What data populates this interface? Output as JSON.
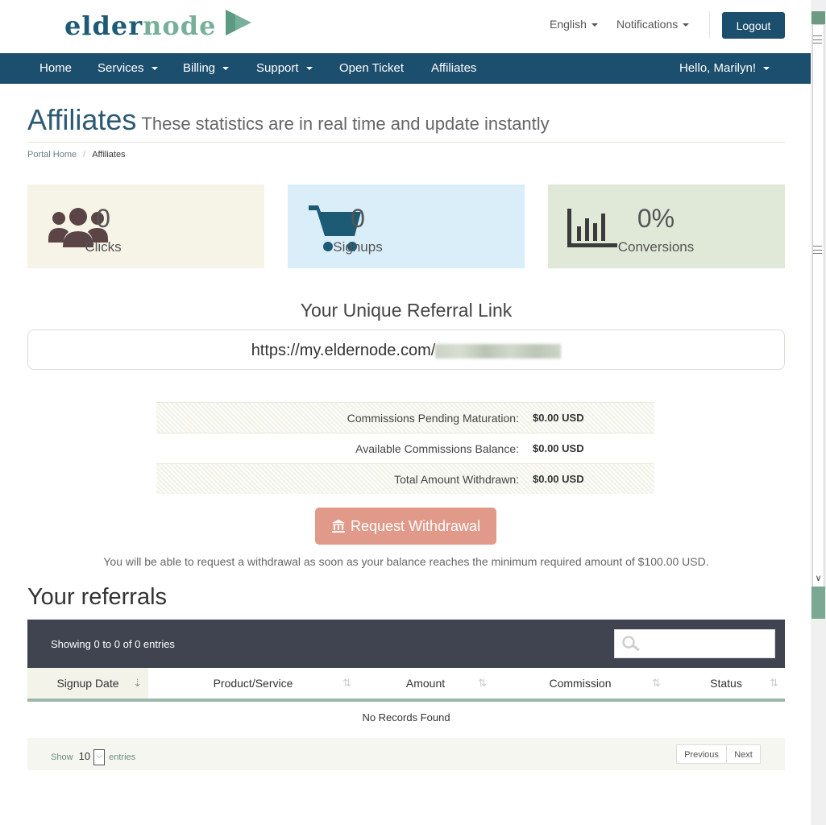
{
  "header": {
    "logo": {
      "part1": "elder",
      "part2": "node"
    },
    "language": "English",
    "notifications": "Notifications",
    "logout": "Logout"
  },
  "nav": {
    "home": "Home",
    "services": "Services",
    "billing": "Billing",
    "support": "Support",
    "open_ticket": "Open Ticket",
    "affiliates": "Affiliates",
    "user_greeting": "Hello, Marilyn!"
  },
  "page": {
    "title": "Affiliates",
    "subtitle": "These statistics are in real time and update instantly",
    "breadcrumb": {
      "home": "Portal Home",
      "current": "Affiliates"
    }
  },
  "stats": {
    "clicks": {
      "value": "0",
      "label": "Clicks",
      "icon": "users-icon",
      "bg": "#f6f3e7"
    },
    "signups": {
      "value": "0",
      "label": "Signups",
      "icon": "cart-icon",
      "bg": "#d9eef8"
    },
    "conversions": {
      "value": "0%",
      "label": "Conversions",
      "icon": "bar-chart-icon",
      "bg": "#e0e8d8"
    }
  },
  "referral": {
    "title": "Your Unique Referral Link",
    "url": "https://my.eldernode.com/"
  },
  "commissions": {
    "pending_label": "Commissions Pending Maturation:",
    "pending_value": "$0.00 USD",
    "available_label": "Available Commissions Balance:",
    "available_value": "$0.00 USD",
    "withdrawn_label": "Total Amount Withdrawn:",
    "withdrawn_value": "$0.00 USD"
  },
  "withdraw": {
    "button": "Request Withdrawal",
    "note": "You will be able to request a withdrawal as soon as your balance reaches the minimum required amount of $100.00 USD."
  },
  "referrals": {
    "heading": "Your referrals",
    "showing": "Showing 0 to 0 of 0 entries",
    "search_placeholder": "",
    "columns": [
      "Signup Date",
      "Product/Service",
      "Amount",
      "Commission",
      "Status"
    ],
    "empty": "No Records Found",
    "footer": {
      "show": "Show",
      "page_size": "10",
      "entries": "entries",
      "previous": "Previous",
      "next": "Next"
    }
  },
  "colors": {
    "brand": "#1c4e6e",
    "accent": "#77b09a",
    "withdraw": "#e19a89"
  }
}
